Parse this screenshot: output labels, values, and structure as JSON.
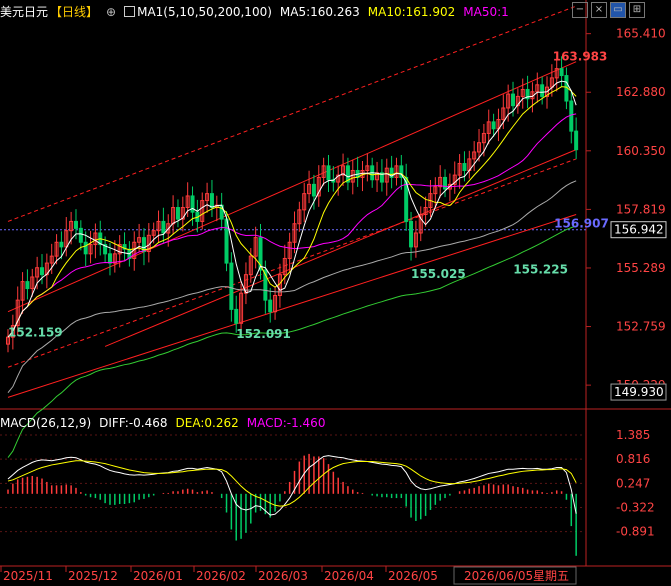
{
  "header": {
    "symbol": "美元日元",
    "period": "【日线】",
    "settings_icon": "⊕",
    "ma_checkbox_label": "MA1(5,10,50,200,100)",
    "ma5": "MA5:160.263",
    "ma10": "MA10:161.902",
    "ma50": "MA50:1"
  },
  "toolbar": {
    "icons": [
      "minus-icon",
      "close-icon",
      "restore-icon",
      "grid-icon"
    ]
  },
  "price_axis": {
    "ticks": [
      "165.410",
      "162.880",
      "160.350",
      "157.819",
      "155.289",
      "152.759",
      "150.229"
    ],
    "current_price": "156.942",
    "lower_box": "149.930"
  },
  "annotations": {
    "high": "163.983",
    "low1": "152.159",
    "low2": "152.091",
    "low3": "155.025",
    "low4": "155.225",
    "line_value": "156.907"
  },
  "macd": {
    "label": "MACD(26,12,9)",
    "diff": "DIFF:-0.468",
    "dea": "DEA:0.262",
    "macd": "MACD:-1.460",
    "ticks": [
      "1.385",
      "0.816",
      "0.247",
      "-0.322",
      "-0.891"
    ]
  },
  "x_axis": {
    "labels": [
      "2025/11",
      "2025/12",
      "2026/01",
      "2026/02",
      "2026/03",
      "2026/04",
      "2026/05"
    ],
    "cursor_date": "2026/06/05",
    "cursor_weekday": "星期五"
  },
  "colors": {
    "up": "#ff3b3b",
    "down": "#00cc66",
    "ma5": "#ffffff",
    "ma10": "#ffff00",
    "ma50": "#ff00ff",
    "ma100": "#aaaaaa",
    "ma200": "#33cc33",
    "channel": "#ff2020"
  },
  "chart_data": {
    "type": "candlestick",
    "title": "美元日元 【日线】",
    "ylim": [
      149.5,
      166.0
    ],
    "closes": [
      152.3,
      152.8,
      153.9,
      154.7,
      154.4,
      154.9,
      155.3,
      155.0,
      155.5,
      155.8,
      156.4,
      156.2,
      156.9,
      157.3,
      157.0,
      156.4,
      155.9,
      156.3,
      156.8,
      156.3,
      155.9,
      155.5,
      155.9,
      156.3,
      156.1,
      155.7,
      156.4,
      156.6,
      156.0,
      156.7,
      156.9,
      157.3,
      156.8,
      157.2,
      157.9,
      157.4,
      157.9,
      158.4,
      157.7,
      157.3,
      158.2,
      158.5,
      157.9,
      158.0,
      157.4,
      155.5,
      153.5,
      152.9,
      154.2,
      155.0,
      155.8,
      156.6,
      155.2,
      153.9,
      153.4,
      154.1,
      155.0,
      155.7,
      156.4,
      157.2,
      157.8,
      158.5,
      158.9,
      158.4,
      159.2,
      159.7,
      159.1,
      159.0,
      159.3,
      159.7,
      159.0,
      159.5,
      159.2,
      159.5,
      159.7,
      159.1,
      159.4,
      159.0,
      159.6,
      159.2,
      159.7,
      159.2,
      157.3,
      156.2,
      156.8,
      157.6,
      157.9,
      158.5,
      158.8,
      159.2,
      158.7,
      158.9,
      159.3,
      159.8,
      159.5,
      160.0,
      160.3,
      160.7,
      161.1,
      161.6,
      161.3,
      161.7,
      162.2,
      162.8,
      162.3,
      162.7,
      163.0,
      162.6,
      162.9,
      163.2,
      162.7,
      163.1,
      163.5,
      163.9,
      163.6,
      162.5,
      161.2,
      160.4
    ],
    "x_labels": [
      "2025/11",
      "2025/12",
      "2026/01",
      "2026/02",
      "2026/03",
      "2026/04",
      "2026/05"
    ],
    "macd_ylim": [
      -1.7,
      1.55
    ],
    "diff": [
      0.35,
      0.45,
      0.55,
      0.62,
      0.68,
      0.74,
      0.78,
      0.8,
      0.79,
      0.78,
      0.8,
      0.82,
      0.85,
      0.86,
      0.85,
      0.8,
      0.75,
      0.72,
      0.7,
      0.66,
      0.6,
      0.55,
      0.52,
      0.5,
      0.47,
      0.45,
      0.44,
      0.45,
      0.44,
      0.45,
      0.46,
      0.48,
      0.49,
      0.5,
      0.53,
      0.54,
      0.57,
      0.6,
      0.6,
      0.58,
      0.6,
      0.62,
      0.6,
      0.58,
      0.52,
      0.3,
      0.0,
      -0.25,
      -0.35,
      -0.38,
      -0.35,
      -0.28,
      -0.3,
      -0.4,
      -0.5,
      -0.48,
      -0.38,
      -0.25,
      -0.1,
      0.1,
      0.3,
      0.48,
      0.62,
      0.7,
      0.8,
      0.88,
      0.9,
      0.88,
      0.86,
      0.85,
      0.82,
      0.8,
      0.78,
      0.77,
      0.76,
      0.74,
      0.72,
      0.7,
      0.69,
      0.67,
      0.66,
      0.64,
      0.5,
      0.3,
      0.18,
      0.12,
      0.1,
      0.12,
      0.15,
      0.18,
      0.2,
      0.22,
      0.24,
      0.28,
      0.3,
      0.33,
      0.36,
      0.4,
      0.44,
      0.48,
      0.5,
      0.52,
      0.55,
      0.58,
      0.58,
      0.59,
      0.6,
      0.59,
      0.59,
      0.6,
      0.58,
      0.58,
      0.59,
      0.62,
      0.62,
      0.5,
      0.1,
      -0.468
    ],
    "dea": [
      0.3,
      0.33,
      0.38,
      0.43,
      0.48,
      0.53,
      0.58,
      0.62,
      0.65,
      0.68,
      0.7,
      0.72,
      0.74,
      0.76,
      0.78,
      0.78,
      0.77,
      0.76,
      0.75,
      0.73,
      0.71,
      0.68,
      0.65,
      0.62,
      0.59,
      0.56,
      0.54,
      0.52,
      0.5,
      0.49,
      0.48,
      0.48,
      0.48,
      0.49,
      0.5,
      0.51,
      0.52,
      0.54,
      0.55,
      0.56,
      0.57,
      0.58,
      0.58,
      0.58,
      0.57,
      0.52,
      0.42,
      0.3,
      0.18,
      0.08,
      0.0,
      -0.06,
      -0.1,
      -0.16,
      -0.22,
      -0.27,
      -0.29,
      -0.28,
      -0.24,
      -0.17,
      -0.08,
      0.03,
      0.15,
      0.26,
      0.36,
      0.46,
      0.55,
      0.62,
      0.67,
      0.71,
      0.73,
      0.75,
      0.76,
      0.76,
      0.76,
      0.76,
      0.75,
      0.74,
      0.73,
      0.72,
      0.71,
      0.69,
      0.65,
      0.58,
      0.5,
      0.42,
      0.36,
      0.31,
      0.28,
      0.26,
      0.25,
      0.24,
      0.24,
      0.25,
      0.26,
      0.27,
      0.29,
      0.31,
      0.34,
      0.36,
      0.39,
      0.42,
      0.44,
      0.47,
      0.49,
      0.51,
      0.53,
      0.54,
      0.55,
      0.56,
      0.56,
      0.57,
      0.57,
      0.58,
      0.59,
      0.57,
      0.48,
      0.262
    ]
  }
}
